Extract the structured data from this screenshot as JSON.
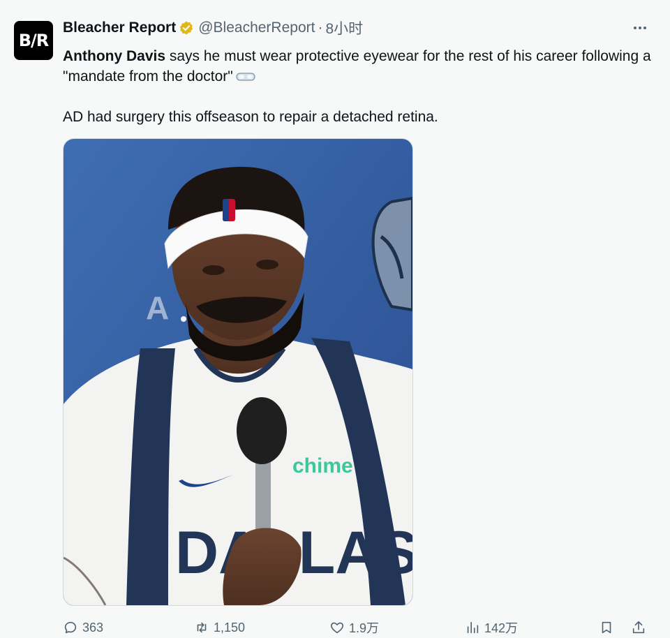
{
  "tweet": {
    "author": {
      "avatar_text": "B/R",
      "name": "Bleacher Report",
      "handle": "@BleacherReport",
      "separator": "·",
      "time": "8小时"
    },
    "text": {
      "bold_name": "Anthony Davis",
      "line1_rest": " says he must wear protective eyewear for the rest of his career following a \"mandate from the doctor\"",
      "paragraph2": "AD had surgery this offseason to repair a detached retina."
    },
    "media": {
      "jersey_text": "DALLAS",
      "sponsor_text": "chime"
    },
    "actions": {
      "replies": "363",
      "retweets": "1,150",
      "likes": "1.9万",
      "views": "142万"
    }
  },
  "colors": {
    "background": "#f7f9f9",
    "text": "#0f1419",
    "secondary": "#536471",
    "verified_gold": "#e2b719"
  },
  "icons": [
    "verified-badge-icon",
    "more-icon",
    "goggles-emoji-icon",
    "reply-icon",
    "retweet-icon",
    "like-icon",
    "views-icon",
    "bookmark-icon",
    "share-icon"
  ]
}
